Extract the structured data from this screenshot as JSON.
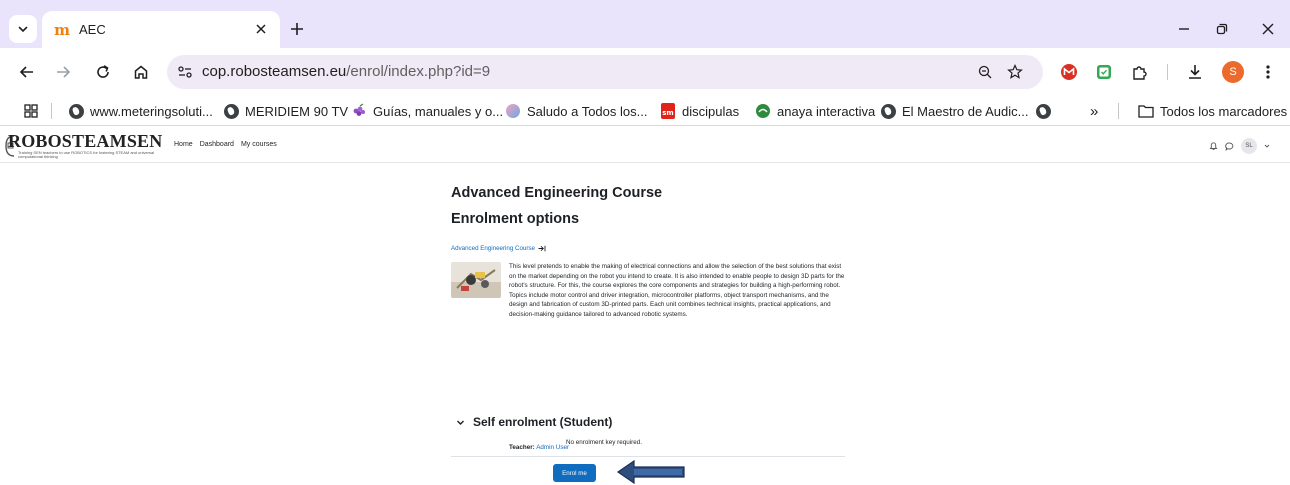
{
  "browser": {
    "tab": {
      "title": "AEC",
      "favicon": "moodle-m-icon"
    },
    "url": {
      "host": "cop.robosteamsen.eu",
      "path": "/enrol/index.php?id=9"
    },
    "profile_initial": "S",
    "bookmarks": [
      {
        "label": "www.meteringsoluti...",
        "icon": "globe-icon"
      },
      {
        "label": "MERIDIEM 90 TV",
        "icon": "globe-icon"
      },
      {
        "label": "Guías, manuales y o...",
        "icon": "grapes-icon"
      },
      {
        "label": "Saludo a Todos los...",
        "icon": "gradient-circle-icon"
      },
      {
        "label": "discipulas",
        "icon": "sm-icon"
      },
      {
        "label": "anaya interactiva",
        "icon": "green-circle-icon"
      },
      {
        "label": "El Maestro de Audic...",
        "icon": "globe-icon"
      },
      {
        "label": "",
        "icon": "globe-icon"
      }
    ],
    "bookmarks_overflow": "»",
    "all_bookmarks": "Todos los marcadores",
    "colors": {
      "tabbar": "#e9e3fb",
      "omnibox": "#efeaf6",
      "accent": "#ec6a2c"
    }
  },
  "site": {
    "brand": "ROBOSTEAMSEN",
    "tagline": "Training SEN teachers to use ROBOTICS for fostering STEAM and universal computational thinking",
    "nav": [
      "Home",
      "Dashboard",
      "My courses"
    ],
    "user_initials": "SL"
  },
  "course": {
    "title": "Advanced Engineering Course",
    "enrolment_heading": "Enrolment options",
    "link_label": "Advanced Engineering Course",
    "summary": "This level pretends to enable the making of electrical connections and allow the selection of the best solutions that exist on the market depending on the robot you intend to create. It is also intended to enable people to design 3D parts for the robot's structure. For this, the course explores the core components and strategies for building a high-performing robot. Topics include motor control and driver integration, microcontroller platforms, object transport mechanisms, and the design and fabrication of custom 3D-printed parts. Each unit combines technical insights, practical applications, and decision-making guidance tailored to advanced robotic systems.",
    "teacher_label": "Teacher:",
    "teacher_name": "Admin User"
  },
  "self_enrolment": {
    "title": "Self enrolment (Student)",
    "note": "No enrolment key required.",
    "button_label": "Enrol me"
  }
}
